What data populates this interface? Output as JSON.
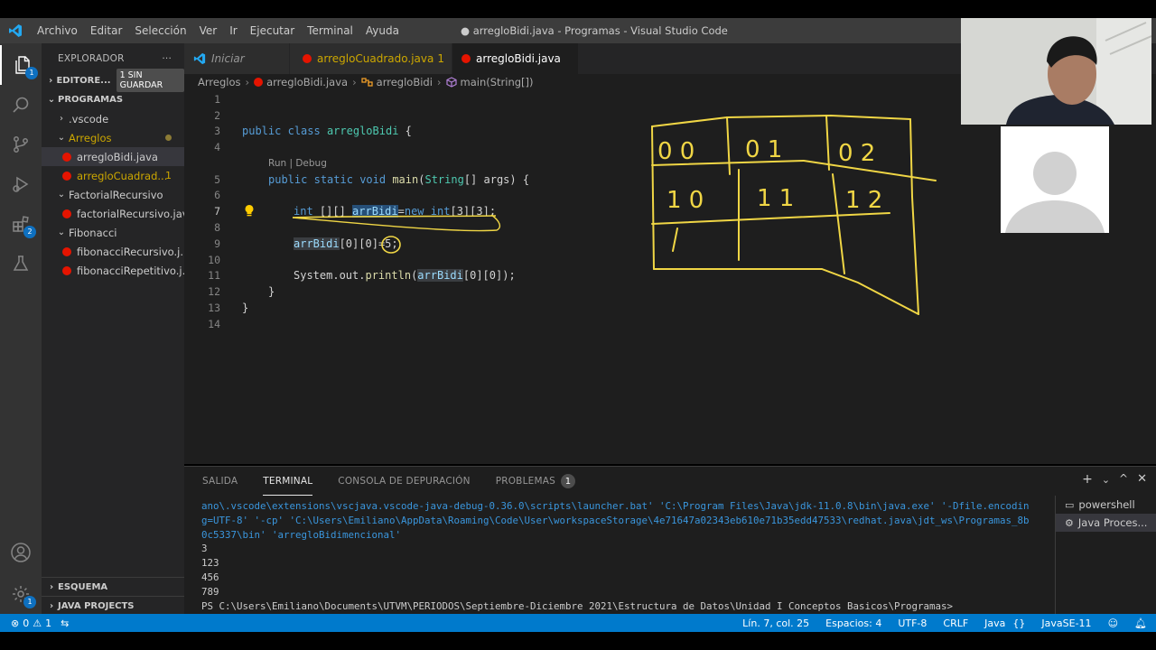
{
  "titlebar": {
    "menu": [
      "Archivo",
      "Editar",
      "Selección",
      "Ver",
      "Ir",
      "Ejecutar",
      "Terminal",
      "Ayuda"
    ],
    "title": "● arregloBidi.java - Programas - Visual Studio Code"
  },
  "activity_badges": {
    "explorer": "1",
    "extensions": "2",
    "manage": "1"
  },
  "sidebar": {
    "header": "EXPLORADOR",
    "more": "···",
    "open_editors": "EDITORE...",
    "unsaved_pill": "1 SIN GUARDAR",
    "workspace": "PROGRAMAS",
    "items": [
      {
        "label": ".vscode",
        "kind": "folder"
      },
      {
        "label": "Arreglos",
        "kind": "folder-open"
      },
      {
        "label": "arregloBidi.java",
        "kind": "file"
      },
      {
        "label": "arregloCuadrad...",
        "kind": "file",
        "count": "1"
      },
      {
        "label": "FactorialRecursivo",
        "kind": "folder-open"
      },
      {
        "label": "factorialRecursivo.java",
        "kind": "file"
      },
      {
        "label": "Fibonacci",
        "kind": "folder-open"
      },
      {
        "label": "fibonacciRecursivo.j...",
        "kind": "file"
      },
      {
        "label": "fibonacciRepetitivo.j...",
        "kind": "file"
      }
    ],
    "outline": "ESQUEMA",
    "java_projects": "JAVA PROJECTS"
  },
  "tabs": [
    {
      "label": "Iniciar",
      "active": false
    },
    {
      "label": "arregloCuadrado.java",
      "count": "1",
      "active": false
    },
    {
      "label": "arregloBidi.java",
      "active": true,
      "dirty": true
    }
  ],
  "breadcrumbs": [
    "Arreglos",
    "arregloBidi.java",
    "arregloBidi",
    "main(String[])"
  ],
  "editor": {
    "line_numbers": [
      "1",
      "2",
      "3",
      "4",
      "5",
      "6",
      "7",
      "8",
      "9",
      "10",
      "11",
      "12",
      "13",
      "14"
    ],
    "codelens": "Run | Debug",
    "code": {
      "l3_public": "public",
      "l3_class": "class",
      "l3_name": "arregloBidi",
      "l3_brace": "{",
      "l5_public": "public",
      "l5_static": "static",
      "l5_void": "void",
      "l5_main": "main",
      "l5_string": "String",
      "l5_rest": "[] args) {",
      "l7_int": "int",
      "l7_dims": " [][] ",
      "l7_var": "arrBidi",
      "l7_eq": "=",
      "l7_new": "new",
      "l7_int2": "int",
      "l7_rest": "[3][3];",
      "l9_var": "arrBidi",
      "l9_idx": "[0][0]",
      "l9_assign": "=5;",
      "l11_sys": "System.out.",
      "l11_println": "println",
      "l11_paren": "(",
      "l11_var": "arrBidi",
      "l11_rest": "[0][0]);",
      "l12_brace": "}",
      "l13_brace": "}"
    },
    "drawing_cells": [
      "0 0",
      "0 1",
      "0 2",
      "1 0",
      "1 1",
      "1 2"
    ]
  },
  "panel": {
    "tabs": [
      "SALIDA",
      "TERMINAL",
      "CONSOLA DE DEPURACIÓN",
      "PROBLEMAS"
    ],
    "problems_count": "1",
    "terminal_lines": [
      "ano\\.vscode\\extensions\\vscjava.vscode-java-debug-0.36.0\\scripts\\launcher.bat' 'C:\\Program Files\\Java\\jdk-11.0.8\\bin\\java.exe' '-Dfile.encodin",
      "g=UTF-8' '-cp' 'C:\\Users\\Emiliano\\AppData\\Roaming\\Code\\User\\workspaceStorage\\4e71647a02343eb610e71b35edd47533\\redhat.java\\jdt_ws\\Programas_8b",
      "0c5337\\bin' 'arregloBidimencional'",
      "3",
      "123",
      "456",
      "789",
      "PS C:\\Users\\Emiliano\\Documents\\UTVM\\PERIODOS\\Septiembre-Diciembre 2021\\Estructura de Datos\\Unidad I Conceptos Basicos\\Programas>"
    ],
    "terminals": [
      "powershell",
      "Java Proces..."
    ]
  },
  "statusbar": {
    "errors": "0",
    "warnings": "1",
    "position": "Lín. 7, col. 25",
    "spaces": "Espacios: 4",
    "encoding": "UTF-8",
    "eol": "CRLF",
    "language": "Java",
    "runtime": "JavaSE-11"
  },
  "colors": {
    "accent": "#007acc",
    "error": "#e51400",
    "warning": "#cca700",
    "drawing": "#f0d645"
  }
}
